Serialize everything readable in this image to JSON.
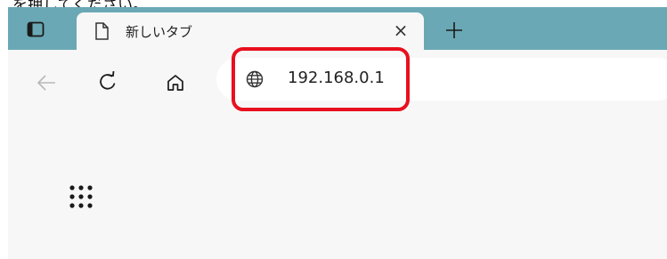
{
  "caption": "を押してください。",
  "browser": {
    "tab": {
      "title": "新しいタブ",
      "close_glyph": "×"
    },
    "new_tab_glyph": "+",
    "address_bar": {
      "url": "192.168.0.1",
      "site_icon": "globe-icon"
    },
    "nav": {
      "back_icon": "arrow-left-icon",
      "refresh_icon": "refresh-icon",
      "home_icon": "home-icon"
    },
    "page": {
      "app_launcher_icon": "grid-dots-icon"
    }
  },
  "annotation": {
    "highlight_color": "#e8101e"
  },
  "colors": {
    "tabbar": "#6aa8b5",
    "toolbar": "#f7f7f7"
  }
}
